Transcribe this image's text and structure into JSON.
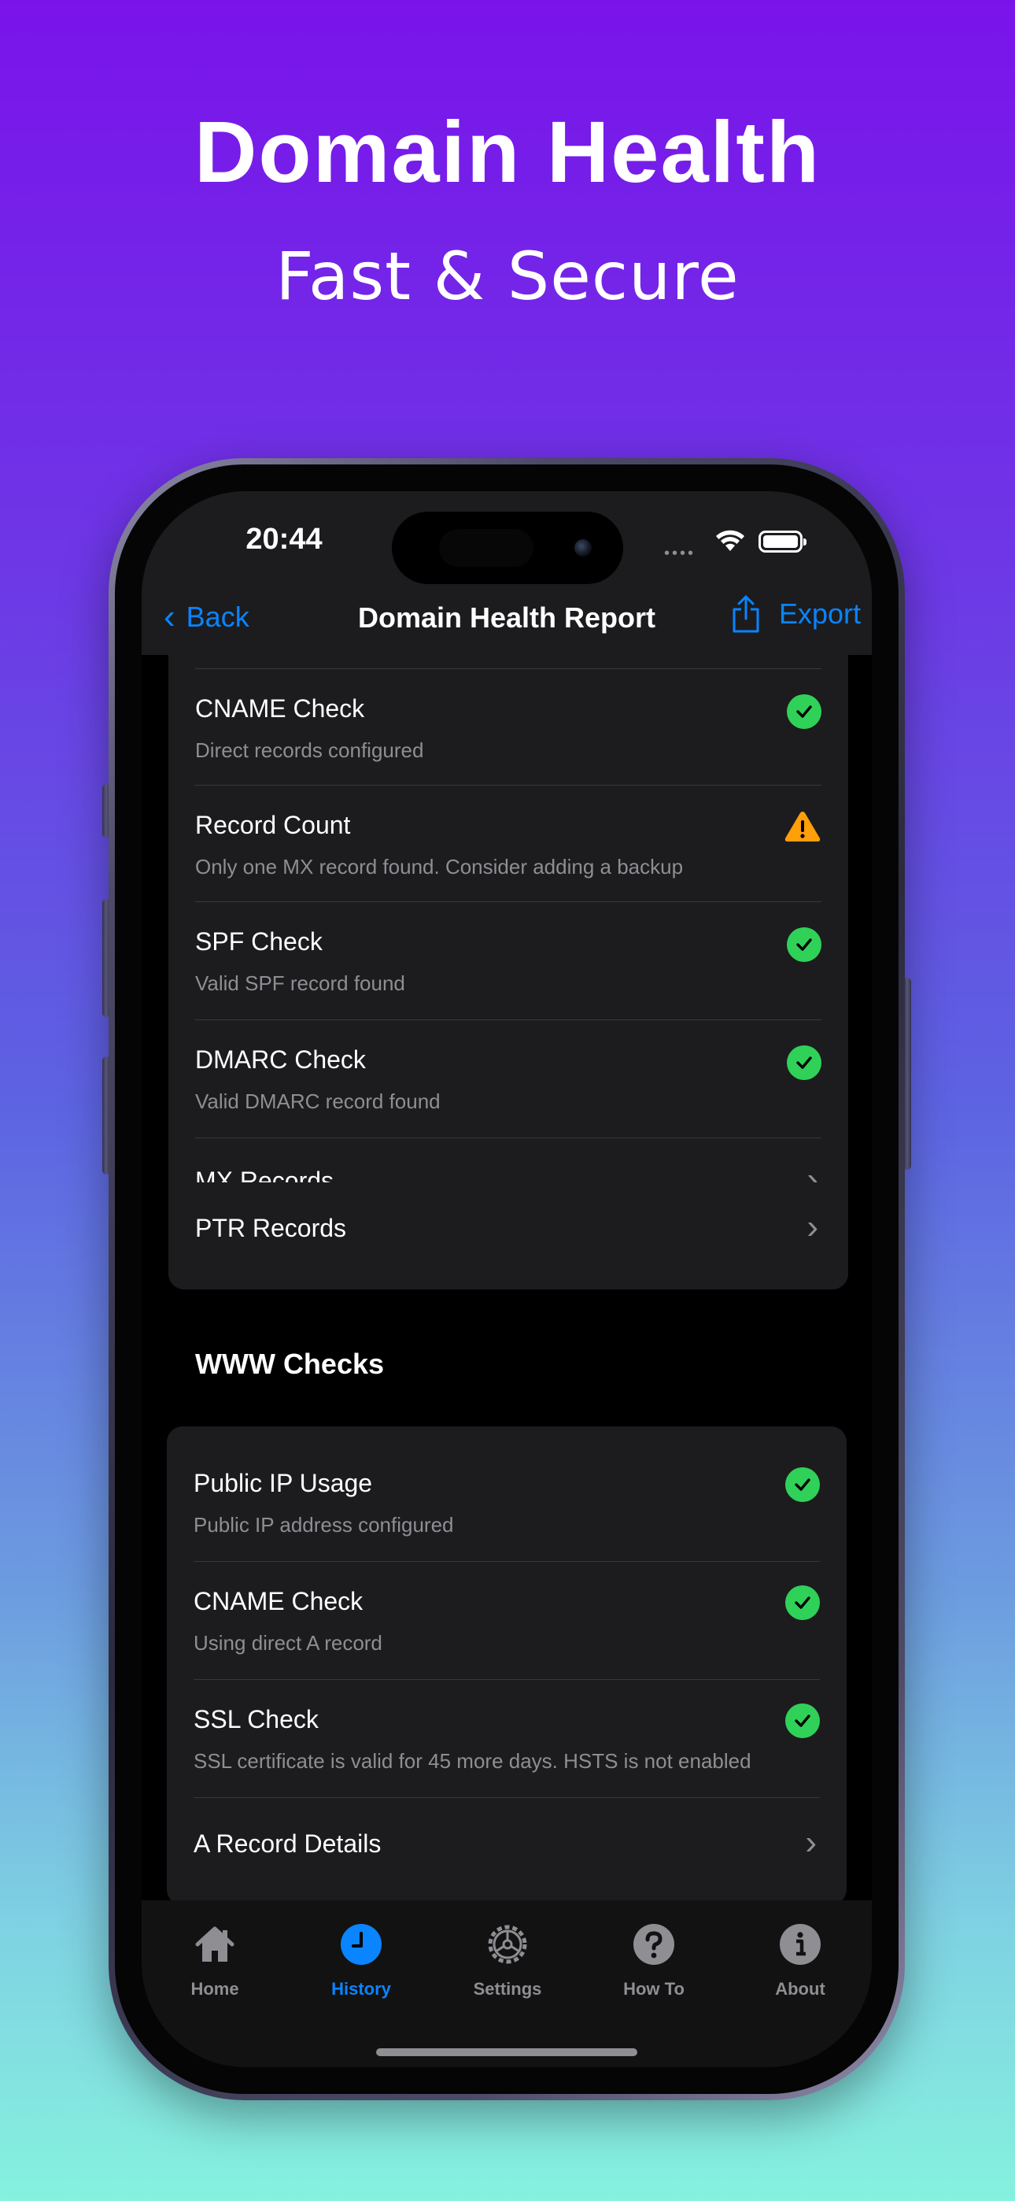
{
  "promo": {
    "headline": "Domain Health",
    "subline": "Fast & Secure"
  },
  "status_bar": {
    "time": "20:44",
    "dots": "••••"
  },
  "nav": {
    "back_label": "Back",
    "title": "Domain Health Report",
    "export_label": "Export"
  },
  "mail_checks": [
    {
      "title": "CNAME Check",
      "desc": "Direct records configured",
      "status": "ok"
    },
    {
      "title": "Record Count",
      "desc": "Only one MX record found. Consider adding a backup",
      "status": "warning"
    },
    {
      "title": "SPF Check",
      "desc": "Valid SPF record found",
      "status": "ok"
    },
    {
      "title": "DMARC Check",
      "desc": "Valid DMARC record found",
      "status": "ok"
    },
    {
      "title": "MX Records",
      "status": "link"
    },
    {
      "title": "PTR Records",
      "status": "link"
    }
  ],
  "www_section": {
    "header": "WWW Checks",
    "items": [
      {
        "title": "Public IP Usage",
        "desc": "Public IP address configured",
        "status": "ok"
      },
      {
        "title": "CNAME Check",
        "desc": "Using direct A record",
        "status": "ok"
      },
      {
        "title": "SSL Check",
        "desc": "SSL certificate is valid for 45 more days. HSTS is not enabled",
        "status": "ok"
      },
      {
        "title": "A Record Details",
        "status": "link"
      }
    ]
  },
  "tabs": [
    {
      "label": "Home",
      "icon": "house-icon",
      "active": false
    },
    {
      "label": "History",
      "icon": "clock-icon",
      "active": true
    },
    {
      "label": "Settings",
      "icon": "gear-icon",
      "active": false
    },
    {
      "label": "How To",
      "icon": "question-icon",
      "active": false
    },
    {
      "label": "About",
      "icon": "info-icon",
      "active": false
    }
  ],
  "colors": {
    "accent": "#0a84ff",
    "ok": "#30d158",
    "warning": "#ff9f0a",
    "card": "#1c1c1e"
  }
}
